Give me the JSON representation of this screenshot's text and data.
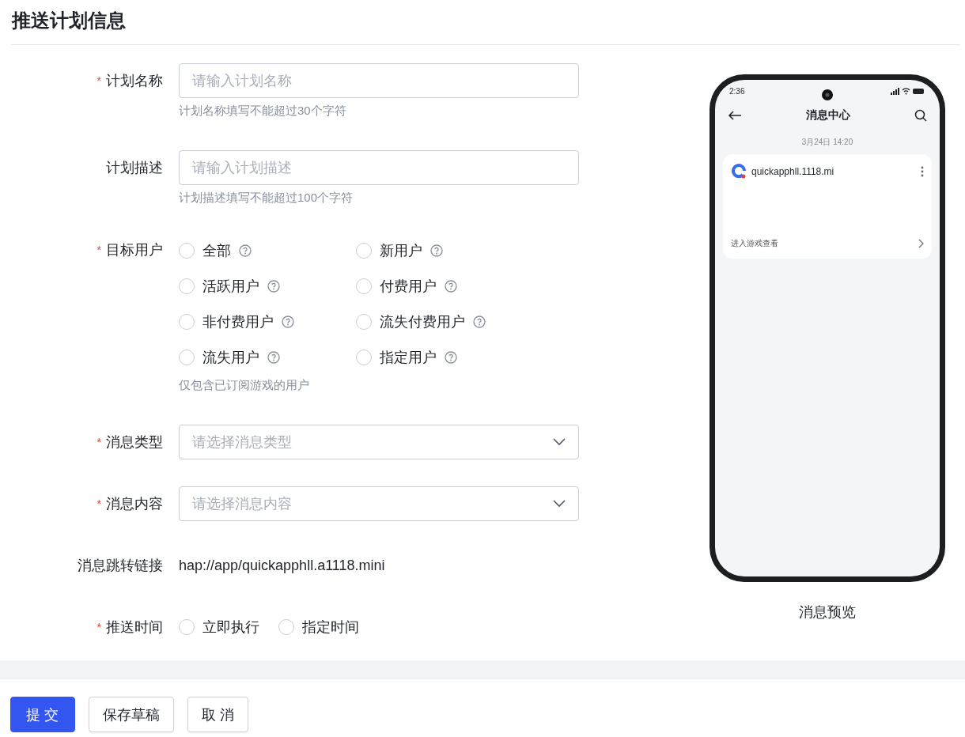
{
  "page": {
    "title": "推送计划信息"
  },
  "form": {
    "fields": [
      {
        "kind": "input",
        "label": "计划名称",
        "required_mark": "*",
        "placeholder": "请输入计划名称",
        "hint": "计划名称填写不能超过30个字符"
      },
      {
        "kind": "input",
        "label": "计划描述",
        "placeholder": "请输入计划描述",
        "hint": "计划描述填写不能超过100个字符"
      },
      {
        "kind": "radio_grid",
        "label": "目标用户",
        "required_mark": "*",
        "hint": "仅包含已订阅游戏的用户",
        "options": [
          {
            "label": "全部",
            "selected": false,
            "help": true
          },
          {
            "label": "新用户",
            "selected": false,
            "help": true
          },
          {
            "label": "活跃用户",
            "selected": false,
            "help": true
          },
          {
            "label": "付费用户",
            "selected": false,
            "help": true
          },
          {
            "label": "非付费用户",
            "selected": false,
            "help": true
          },
          {
            "label": "流失付费用户",
            "selected": false,
            "help": true
          },
          {
            "label": "流失用户",
            "selected": false,
            "help": true
          },
          {
            "label": "指定用户",
            "selected": false,
            "help": true
          }
        ]
      },
      {
        "kind": "select",
        "label": "消息类型",
        "required_mark": "*",
        "placeholder": "请选择消息类型"
      },
      {
        "kind": "select",
        "label": "消息内容",
        "required_mark": "*",
        "placeholder": "请选择消息内容"
      },
      {
        "kind": "text",
        "label": "消息跳转链接",
        "value": "hap://app/quickapphll.a1118.mini"
      },
      {
        "kind": "radio_row",
        "label": "推送时间",
        "required_mark": "*",
        "options": [
          {
            "label": "立即执行",
            "selected": false
          },
          {
            "label": "指定时间",
            "selected": false
          }
        ]
      }
    ]
  },
  "preview": {
    "status_time": "2:36",
    "screen_title": "消息中心",
    "date": "3月24日 14:20",
    "app_name": "quickapphll.1118.mi",
    "card_link": "进入游戏查看",
    "caption": "消息预览"
  },
  "footer": {
    "buttons": [
      {
        "label": "提 交",
        "kind": "primary"
      },
      {
        "label": "保存草稿",
        "kind": "default"
      },
      {
        "label": "取 消",
        "kind": "default"
      }
    ]
  }
}
